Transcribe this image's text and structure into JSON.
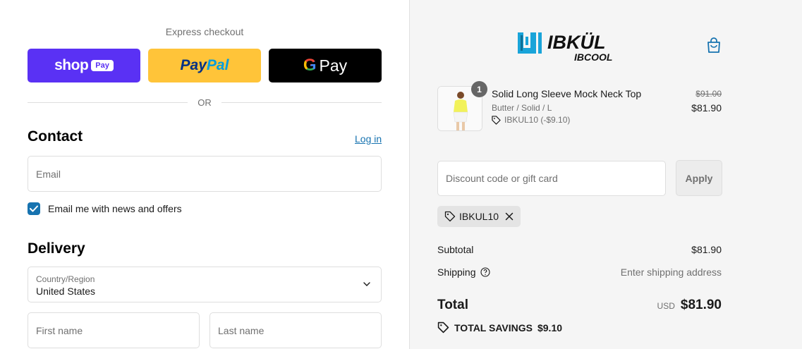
{
  "express": {
    "label": "Express checkout",
    "shop_word": "shop",
    "shop_badge": "Pay",
    "paypal_part1": "Pay",
    "paypal_part2": "Pal",
    "gpay_g": "G",
    "gpay_word": "Pay",
    "or": "OR"
  },
  "contact": {
    "title": "Contact",
    "login": "Log in",
    "email_placeholder": "Email",
    "newsletter_label": "Email me with news and offers",
    "newsletter_checked": true
  },
  "delivery": {
    "title": "Delivery",
    "country_label": "Country/Region",
    "country_value": "United States",
    "first_name_placeholder": "First name",
    "last_name_placeholder": "Last name"
  },
  "brand": {
    "name": "IBKÜL",
    "sub": "IBCOOL",
    "color": "#19a4d9"
  },
  "cart": {
    "icon": "shopping-bag-icon",
    "item": {
      "quantity": "1",
      "title": "Solid Long Sleeve Mock Neck Top",
      "variant": "Butter / Solid / L",
      "discount": "IBKUL10 (-$9.10)",
      "original_price": "$91.00",
      "price": "$81.90"
    }
  },
  "discount": {
    "placeholder": "Discount code or gift card",
    "apply": "Apply",
    "applied_code": "IBKUL10"
  },
  "summary": {
    "subtotal_label": "Subtotal",
    "subtotal_value": "$81.90",
    "shipping_label": "Shipping",
    "shipping_value": "Enter shipping address",
    "total_label": "Total",
    "currency": "USD",
    "total_value": "$81.90",
    "savings_label": "TOTAL SAVINGS",
    "savings_value": "$9.10"
  },
  "colors": {
    "link": "#1773b0",
    "shop_pay": "#5a31f4",
    "paypal": "#ffc439"
  }
}
